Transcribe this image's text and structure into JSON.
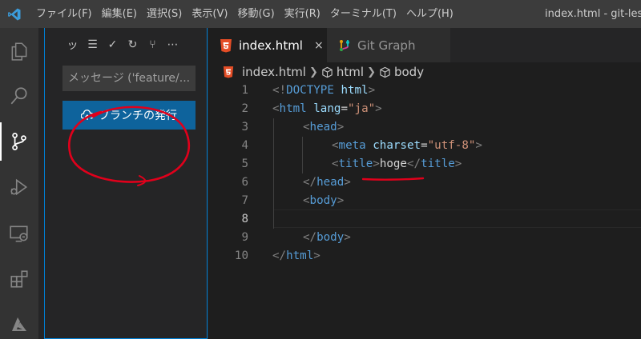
{
  "titlebar": {
    "menu": [
      "ファイル(F)",
      "編集(E)",
      "選択(S)",
      "表示(V)",
      "移動(G)",
      "実行(R)",
      "ターミナル(T)",
      "ヘルプ(H)"
    ],
    "window_title": "index.html - git-les"
  },
  "activity_bar": {
    "items": [
      "explorer-icon",
      "search-icon",
      "source-control-icon",
      "run-debug-icon",
      "remote-explorer-icon",
      "extensions-icon",
      "azure-icon"
    ],
    "active": "source-control-icon"
  },
  "sidebar": {
    "toolbar": [
      "ッ",
      "☰",
      "✓",
      "↻",
      "⑂",
      "⋯"
    ],
    "commit_placeholder": "メッセージ ('feature/...",
    "publish_button": "ブランチの発行"
  },
  "tabs": [
    {
      "label": "index.html",
      "icon": "html5-icon",
      "active": true,
      "close": "×"
    },
    {
      "label": "Git Graph",
      "icon": "git-graph-icon",
      "active": false
    }
  ],
  "breadcrumb": [
    "index.html",
    "html",
    "body"
  ],
  "editor": {
    "line_numbers": [
      "1",
      "2",
      "3",
      "4",
      "5",
      "6",
      "7",
      "8",
      "9",
      "10"
    ],
    "current_line": "8",
    "tokens": {
      "l1_open": "<!",
      "l1_doctype": "DOCTYPE",
      "l1_html": "html",
      "l1_close": ">",
      "l2_open": "<",
      "l2_tag": "html",
      "l2_attr": "lang",
      "l2_eq": "=",
      "l2_val": "\"ja\"",
      "l2_close": ">",
      "l3_open": "<",
      "l3_tag": "head",
      "l3_close": ">",
      "l4_open": "<",
      "l4_tag": "meta",
      "l4_attr": "charset",
      "l4_eq": "=",
      "l4_val": "\"utf-8\"",
      "l4_close": ">",
      "l5_open": "<",
      "l5_tag": "title",
      "l5_close1": ">",
      "l5_text": "hoge",
      "l5_open2": "</",
      "l5_tag2": "title",
      "l5_close2": ">",
      "l6_open": "</",
      "l6_tag": "head",
      "l6_close": ">",
      "l7_open": "<",
      "l7_tag": "body",
      "l7_close": ">",
      "l9_open": "</",
      "l9_tag": "body",
      "l9_close": ">",
      "l10_open": "</",
      "l10_tag": "html",
      "l10_close": ">"
    }
  },
  "colors": {
    "accent": "#007fd4",
    "button": "#0e639c",
    "annotation": "#e0001b",
    "tag": "#569cd6",
    "attribute": "#9cdcfe",
    "string": "#ce9178"
  }
}
